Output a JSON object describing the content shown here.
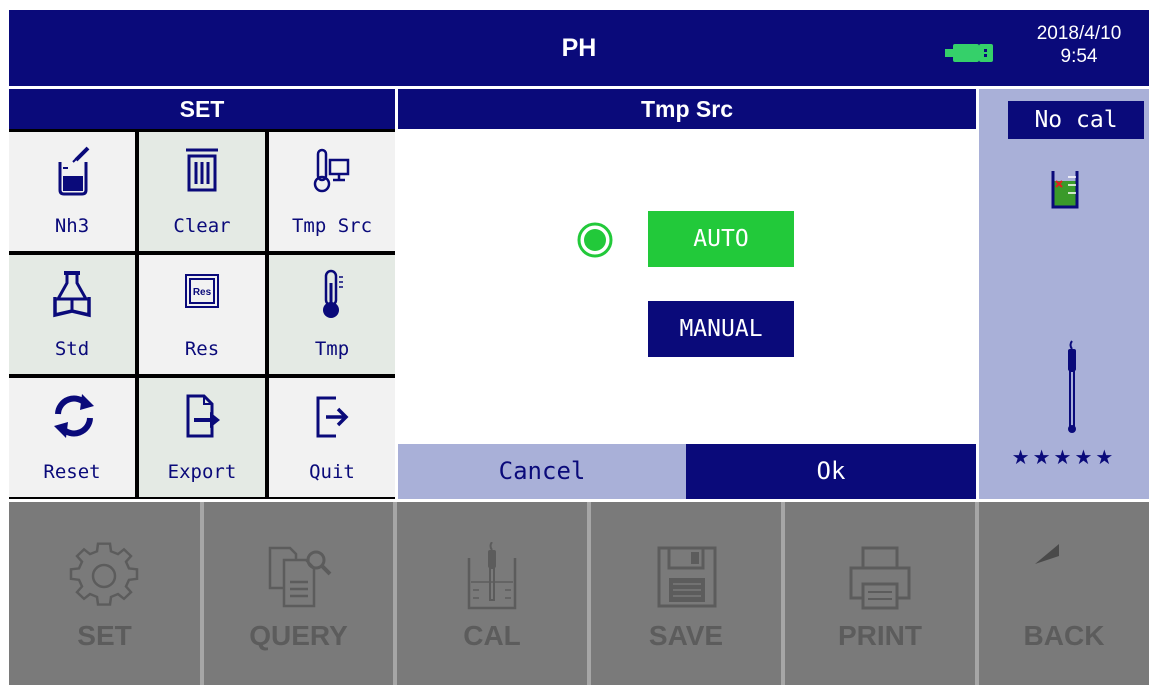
{
  "titlebar": {
    "title": "PH",
    "date": "2018/4/10",
    "time": "9:54"
  },
  "set_panel": {
    "header": "SET",
    "items": [
      {
        "label": "Nh3",
        "icon": "beaker-dropper-icon"
      },
      {
        "label": "Clear",
        "icon": "trash-icon"
      },
      {
        "label": "Tmp Src",
        "icon": "thermometer-screen-icon"
      },
      {
        "label": "Std",
        "icon": "book-flask-icon"
      },
      {
        "label": "Res",
        "icon": "chip-icon"
      },
      {
        "label": "Tmp",
        "icon": "thermometer-icon"
      },
      {
        "label": "Reset",
        "icon": "refresh-icon"
      },
      {
        "label": "Export",
        "icon": "export-icon"
      },
      {
        "label": "Quit",
        "icon": "quit-icon"
      }
    ]
  },
  "dialog": {
    "title": "Tmp Src",
    "auto_label": "AUTO",
    "manual_label": "MANUAL",
    "selected": "AUTO",
    "cancel_label": "Cancel",
    "ok_label": "Ok"
  },
  "status": {
    "cal_status": "No cal",
    "stars": "★★★★★"
  },
  "toolbar": {
    "set": "SET",
    "query": "QUERY",
    "cal": "CAL",
    "save": "SAVE",
    "print": "PRINT",
    "back": "BACK"
  },
  "colors": {
    "navy": "#0a0a7a",
    "accent_green": "#22c93a",
    "panel_lavender": "#a9b0d8",
    "toolbar_gray": "#7a7a7a"
  }
}
